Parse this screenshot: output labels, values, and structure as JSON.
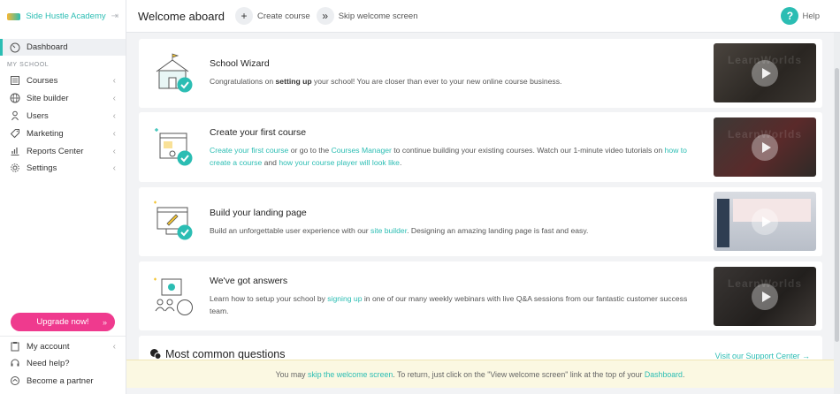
{
  "sidebar": {
    "brand": "Side Hustle Academy",
    "dashboard": "Dashboard",
    "section": "MY SCHOOL",
    "items": [
      {
        "label": "Courses",
        "icon": "courses-icon"
      },
      {
        "label": "Site builder",
        "icon": "globe-icon"
      },
      {
        "label": "Users",
        "icon": "user-icon"
      },
      {
        "label": "Marketing",
        "icon": "tag-icon"
      },
      {
        "label": "Reports Center",
        "icon": "chart-icon"
      },
      {
        "label": "Settings",
        "icon": "gear-icon"
      }
    ],
    "upgrade": "Upgrade now!",
    "bottom": [
      {
        "label": "My account"
      },
      {
        "label": "Need help?"
      },
      {
        "label": "Become a partner"
      }
    ]
  },
  "topbar": {
    "title": "Welcome aboard",
    "create_course": "Create course",
    "skip": "Skip welcome screen",
    "help": "Help"
  },
  "cards": [
    {
      "title": "School Wizard",
      "desc_pre": "Congratulations on ",
      "desc_bold": "setting up",
      "desc_post": " your school! You are closer than ever to your new online course business."
    },
    {
      "title": "Create your first course",
      "link1": "Create your first course",
      "t1": " or go to the ",
      "link2": "Courses Manager",
      "t2": " to continue building your existing courses. Watch our 1-minute video tutorials on ",
      "link3": "how to create a course",
      "t3": " and ",
      "link4": "how your course player will look like",
      "t4": "."
    },
    {
      "title": "Build your landing page",
      "t1": "Build an unforgettable user experience with our ",
      "link1": "site builder",
      "t2": ". Designing an amazing landing page is fast and easy."
    },
    {
      "title": "We've got answers",
      "t1": "Learn how to setup your school by ",
      "link1": "signing up",
      "t2": " in one of our many weekly webinars with live Q&A sessions from our fantastic customer success team."
    }
  ],
  "faq": {
    "title": "Most common questions",
    "support": "Visit our Support Center  →"
  },
  "banner": {
    "t1": "You may ",
    "link1": "skip the welcome screen",
    "t2": ". To return, just click on the \"View welcome screen\" link at the top of your ",
    "link2": "Dashboard",
    "t3": "."
  },
  "colors": {
    "accent": "#2bbdb3",
    "upgrade": "#ef3a8e"
  }
}
